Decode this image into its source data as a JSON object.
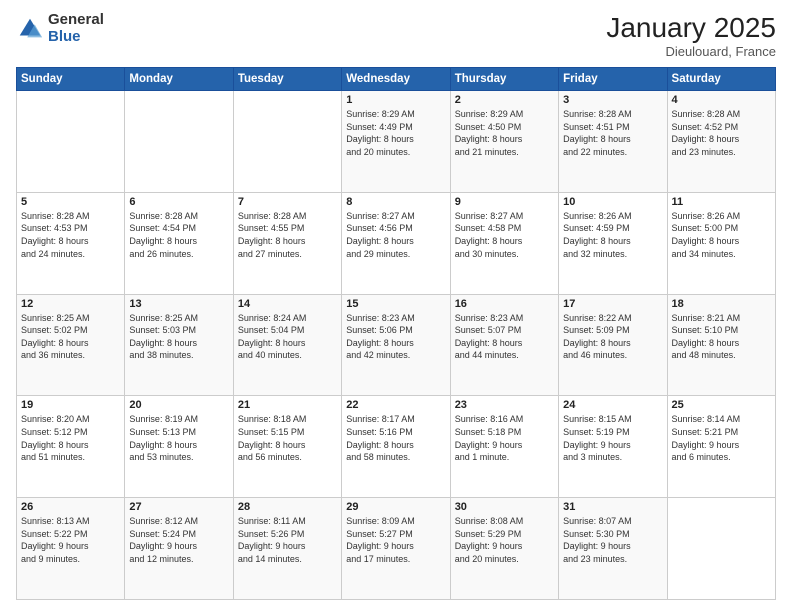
{
  "header": {
    "logo_general": "General",
    "logo_blue": "Blue",
    "month_title": "January 2025",
    "location": "Dieulouard, France"
  },
  "days_of_week": [
    "Sunday",
    "Monday",
    "Tuesday",
    "Wednesday",
    "Thursday",
    "Friday",
    "Saturday"
  ],
  "weeks": [
    [
      {
        "day": "",
        "info": ""
      },
      {
        "day": "",
        "info": ""
      },
      {
        "day": "",
        "info": ""
      },
      {
        "day": "1",
        "info": "Sunrise: 8:29 AM\nSunset: 4:49 PM\nDaylight: 8 hours\nand 20 minutes."
      },
      {
        "day": "2",
        "info": "Sunrise: 8:29 AM\nSunset: 4:50 PM\nDaylight: 8 hours\nand 21 minutes."
      },
      {
        "day": "3",
        "info": "Sunrise: 8:28 AM\nSunset: 4:51 PM\nDaylight: 8 hours\nand 22 minutes."
      },
      {
        "day": "4",
        "info": "Sunrise: 8:28 AM\nSunset: 4:52 PM\nDaylight: 8 hours\nand 23 minutes."
      }
    ],
    [
      {
        "day": "5",
        "info": "Sunrise: 8:28 AM\nSunset: 4:53 PM\nDaylight: 8 hours\nand 24 minutes."
      },
      {
        "day": "6",
        "info": "Sunrise: 8:28 AM\nSunset: 4:54 PM\nDaylight: 8 hours\nand 26 minutes."
      },
      {
        "day": "7",
        "info": "Sunrise: 8:28 AM\nSunset: 4:55 PM\nDaylight: 8 hours\nand 27 minutes."
      },
      {
        "day": "8",
        "info": "Sunrise: 8:27 AM\nSunset: 4:56 PM\nDaylight: 8 hours\nand 29 minutes."
      },
      {
        "day": "9",
        "info": "Sunrise: 8:27 AM\nSunset: 4:58 PM\nDaylight: 8 hours\nand 30 minutes."
      },
      {
        "day": "10",
        "info": "Sunrise: 8:26 AM\nSunset: 4:59 PM\nDaylight: 8 hours\nand 32 minutes."
      },
      {
        "day": "11",
        "info": "Sunrise: 8:26 AM\nSunset: 5:00 PM\nDaylight: 8 hours\nand 34 minutes."
      }
    ],
    [
      {
        "day": "12",
        "info": "Sunrise: 8:25 AM\nSunset: 5:02 PM\nDaylight: 8 hours\nand 36 minutes."
      },
      {
        "day": "13",
        "info": "Sunrise: 8:25 AM\nSunset: 5:03 PM\nDaylight: 8 hours\nand 38 minutes."
      },
      {
        "day": "14",
        "info": "Sunrise: 8:24 AM\nSunset: 5:04 PM\nDaylight: 8 hours\nand 40 minutes."
      },
      {
        "day": "15",
        "info": "Sunrise: 8:23 AM\nSunset: 5:06 PM\nDaylight: 8 hours\nand 42 minutes."
      },
      {
        "day": "16",
        "info": "Sunrise: 8:23 AM\nSunset: 5:07 PM\nDaylight: 8 hours\nand 44 minutes."
      },
      {
        "day": "17",
        "info": "Sunrise: 8:22 AM\nSunset: 5:09 PM\nDaylight: 8 hours\nand 46 minutes."
      },
      {
        "day": "18",
        "info": "Sunrise: 8:21 AM\nSunset: 5:10 PM\nDaylight: 8 hours\nand 48 minutes."
      }
    ],
    [
      {
        "day": "19",
        "info": "Sunrise: 8:20 AM\nSunset: 5:12 PM\nDaylight: 8 hours\nand 51 minutes."
      },
      {
        "day": "20",
        "info": "Sunrise: 8:19 AM\nSunset: 5:13 PM\nDaylight: 8 hours\nand 53 minutes."
      },
      {
        "day": "21",
        "info": "Sunrise: 8:18 AM\nSunset: 5:15 PM\nDaylight: 8 hours\nand 56 minutes."
      },
      {
        "day": "22",
        "info": "Sunrise: 8:17 AM\nSunset: 5:16 PM\nDaylight: 8 hours\nand 58 minutes."
      },
      {
        "day": "23",
        "info": "Sunrise: 8:16 AM\nSunset: 5:18 PM\nDaylight: 9 hours\nand 1 minute."
      },
      {
        "day": "24",
        "info": "Sunrise: 8:15 AM\nSunset: 5:19 PM\nDaylight: 9 hours\nand 3 minutes."
      },
      {
        "day": "25",
        "info": "Sunrise: 8:14 AM\nSunset: 5:21 PM\nDaylight: 9 hours\nand 6 minutes."
      }
    ],
    [
      {
        "day": "26",
        "info": "Sunrise: 8:13 AM\nSunset: 5:22 PM\nDaylight: 9 hours\nand 9 minutes."
      },
      {
        "day": "27",
        "info": "Sunrise: 8:12 AM\nSunset: 5:24 PM\nDaylight: 9 hours\nand 12 minutes."
      },
      {
        "day": "28",
        "info": "Sunrise: 8:11 AM\nSunset: 5:26 PM\nDaylight: 9 hours\nand 14 minutes."
      },
      {
        "day": "29",
        "info": "Sunrise: 8:09 AM\nSunset: 5:27 PM\nDaylight: 9 hours\nand 17 minutes."
      },
      {
        "day": "30",
        "info": "Sunrise: 8:08 AM\nSunset: 5:29 PM\nDaylight: 9 hours\nand 20 minutes."
      },
      {
        "day": "31",
        "info": "Sunrise: 8:07 AM\nSunset: 5:30 PM\nDaylight: 9 hours\nand 23 minutes."
      },
      {
        "day": "",
        "info": ""
      }
    ]
  ]
}
